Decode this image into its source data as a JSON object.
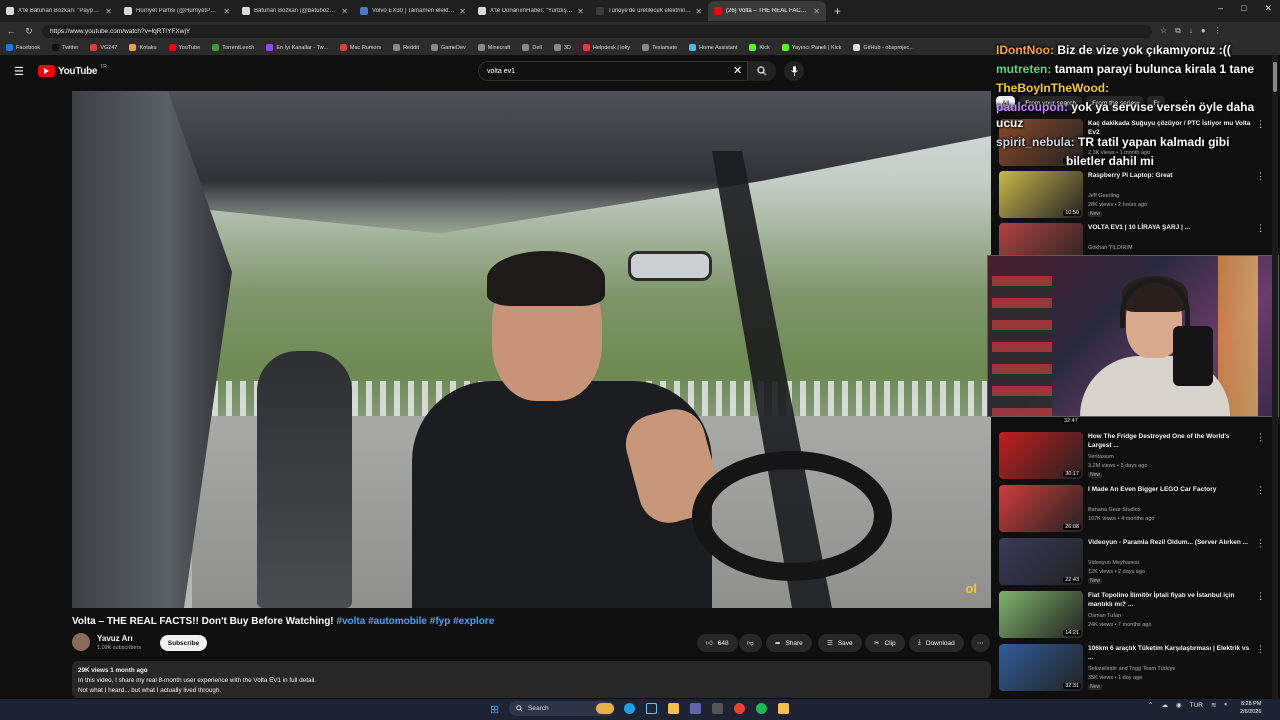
{
  "browser": {
    "tabs": [
      {
        "label": "X'te Batuhan Bozkan: \"Paypal, App...",
        "color": "#d9d9d9",
        "active": false
      },
      {
        "label": "Hürriyet Partisi (@HurriyetPartiliT)",
        "color": "#d9d9d9",
        "active": false
      },
      {
        "label": "Batuhan Bozkan (@batubozkan) / ...",
        "color": "#d9d9d9",
        "active": false
      },
      {
        "label": "Volvo EX30 | Tamamen elektrikli...",
        "color": "#4a79c8",
        "active": false
      },
      {
        "label": "X'te DonanımHaber: \"Yurtdışı...",
        "color": "#d9d9d9",
        "active": false
      },
      {
        "label": "Türkiye'de üretilecek elektrikli Hy...",
        "color": "#3b3b3b",
        "active": false
      },
      {
        "label": "(26) Volta – THE REAL FACTS!!...",
        "color": "#ff0000",
        "active": true
      }
    ],
    "new_tab": "+",
    "url": "https://www.youtube.com/watch?v=lqRTIYFXwjY",
    "bookmarks": [
      {
        "label": "Facebook",
        "color": "#1877f2"
      },
      {
        "label": "Twitter",
        "color": "#111111"
      },
      {
        "label": "VG247",
        "color": "#e03a3a"
      },
      {
        "label": "Kotaku",
        "color": "#f2a33a"
      },
      {
        "label": "YouTube",
        "color": "#ff0000"
      },
      {
        "label": "TorrentLeech",
        "color": "#3a9a3a"
      },
      {
        "label": "En İyi Kanallar - Tw...",
        "color": "#9146ff"
      },
      {
        "label": "Mac Rumors",
        "color": "#e03a3a"
      },
      {
        "label": "Reddit",
        "color": "#888888"
      },
      {
        "label": "GameDev",
        "color": "#888888"
      },
      {
        "label": "Minecraft",
        "color": "#888888"
      },
      {
        "label": "Dell",
        "color": "#888888"
      },
      {
        "label": "3D",
        "color": "#888888"
      },
      {
        "label": "Helpdesk | loky",
        "color": "#e03a3a"
      },
      {
        "label": "Tesiamate",
        "color": "#888888"
      },
      {
        "label": "Home Assistant",
        "color": "#41bdf5"
      },
      {
        "label": "Kick",
        "color": "#53fc18"
      },
      {
        "label": "Yayıncı Paneli | Kick",
        "color": "#53fc18"
      },
      {
        "label": "GitHub - obsprojec...",
        "color": "#dddddd"
      }
    ]
  },
  "youtube": {
    "logo_text": "YouTube",
    "logo_region": "TR",
    "search_value": "volta ev1",
    "video_watermark": "ol"
  },
  "video": {
    "title": "Volta – THE REAL FACTS!! Don't Buy Before Watching!",
    "hashtags": "#volta #automobile #fyp #explore",
    "channel": "Yavuz Arı",
    "subscribers": "1.09K subscribers",
    "subscribe_label": "Subscribe",
    "likes": "648",
    "share_label": "Share",
    "save_label": "Save",
    "clip_label": "Clip",
    "download_label": "Download",
    "views_date": "29K views  1 month ago",
    "description_line1": "In this video, I share my real 8-month user experience with the Volta EV1 in full detail.",
    "description_line2": "Not what I heard... but what I actually lived through."
  },
  "sidebar": {
    "chips": [
      "All",
      "From your search",
      "From the series",
      "Fr"
    ],
    "recommendations": [
      {
        "title": "Kaç dakikada Suğuyu çözüyor / PTC İstiyor mu Volta Ev2",
        "channel": "",
        "views": "2.3K views • 1 month ago",
        "duration": "10:31",
        "thumb": "#8a4a2a",
        "new": false
      },
      {
        "title": "Raspberry Pi Laptop: Great",
        "channel": "Jeff Geerling",
        "views": "28K views • 2 hours ago",
        "duration": "10:50",
        "thumb": "#c7b84a",
        "new": true
      },
      {
        "title": "VOLTA EV1 | 10 LİRAYA ŞARJ | ...",
        "channel": "Gökhan YILDIRIM",
        "views": "",
        "duration": "",
        "thumb": "#b34242",
        "new": false
      },
      {
        "title": "How The Fridge Destroyed One of the World's Largest ...",
        "channel": "Veritasium",
        "views": "3.2M views • 3 days ago",
        "duration": "30:17",
        "thumb": "#c41e1e",
        "new": true
      },
      {
        "title": "I Made An Even Bigger LEGO Car Factory",
        "channel": "Banana Gear Studios",
        "views": "107K views • 4 months ago",
        "duration": "26:08",
        "thumb": "#d23c3c",
        "new": false
      },
      {
        "title": "Videoyun - Paramla Rezil Oldum... (Server Alırken ...",
        "channel": "Videoyun Meyhanesi",
        "views": "12K views • 2 days ago",
        "duration": "22:43",
        "thumb": "#3a3a5a",
        "new": true
      },
      {
        "title": "Fiat Topolino İlimitör İptali fiyatı ve İstanbul için mantıklı mı? ...",
        "channel": "Osman Tufan",
        "views": "24K views • 7 months ago",
        "duration": "14:21",
        "thumb": "#7fb36a",
        "new": false
      },
      {
        "title": "106km 6 araçlık Tüketim Karşılaştırması | Elektrik vs ...",
        "channel": "Sekizsilindir and Togg Team Türkiye",
        "views": "35K views • 1 day ago",
        "duration": "32:31",
        "thumb": "#2f5d9a",
        "new": true
      }
    ],
    "hidden_duration": "32:47",
    "new_badge": "New"
  },
  "chat": [
    {
      "user": "IDontNoo:",
      "color": "#f2a33a",
      "text": "Biz de vize yok çıkamıyoruz :(("
    },
    {
      "user": "mutreten:",
      "color": "#4ade80",
      "text": "tamam parayi bulunca kirala 1 tane"
    },
    {
      "user": "TheBoyInTheWood:",
      "color": "#facc15",
      "text": ""
    },
    {
      "user": "paulcoupon:",
      "color": "#c084fc",
      "text": "yok ya servise versen öyle daha ucuz"
    },
    {
      "user": "spirit_nebula:",
      "color": "#d1d5db",
      "text": "TR tatil yapan kalmadı gibi"
    },
    {
      "user": "",
      "color": "#ffffff",
      "text": "biletler dahil mi"
    }
  ],
  "taskbar": {
    "search_label": "Search",
    "language": "TUR",
    "time": "8:28 PM",
    "date": "2/6/2026"
  }
}
